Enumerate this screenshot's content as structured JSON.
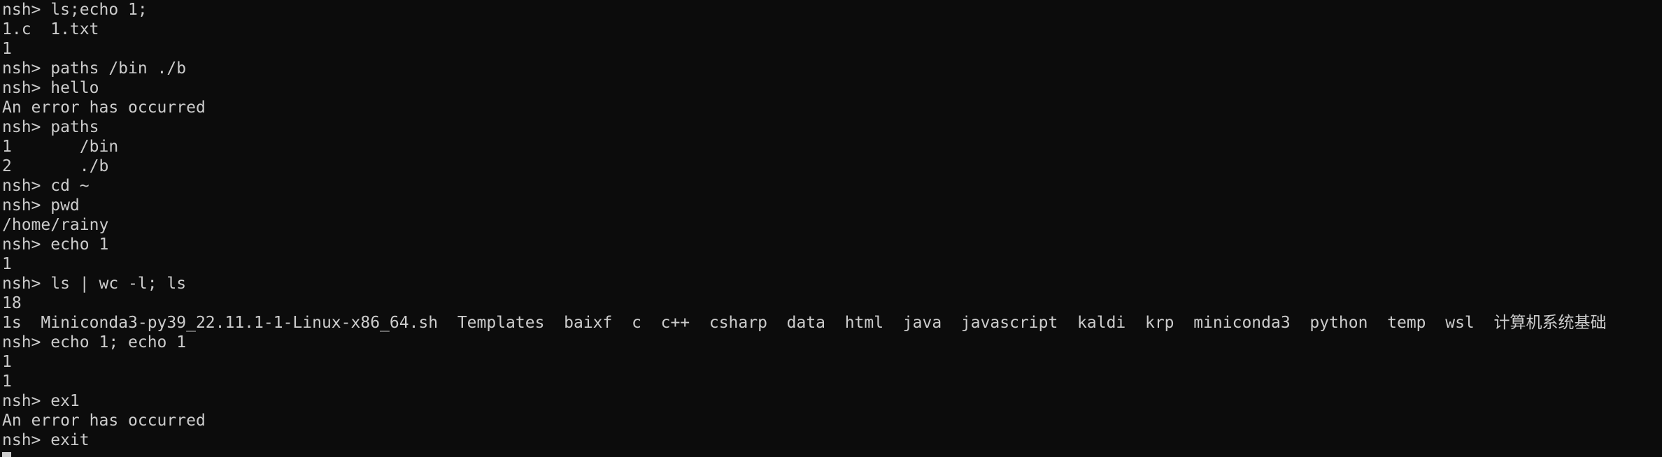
{
  "terminal": {
    "lines": [
      "nsh> ls;echo 1;",
      "1.c  1.txt",
      "1",
      "nsh> paths /bin ./b",
      "nsh> hello",
      "An error has occurred",
      "nsh> paths",
      "1       /bin",
      "2       ./b",
      "nsh> cd ~",
      "nsh> pwd",
      "/home/rainy",
      "nsh> echo 1",
      "1",
      "nsh> ls | wc -l; ls",
      "18",
      "1s  Miniconda3-py39_22.11.1-1-Linux-x86_64.sh  Templates  baixf  c  c++  csharp  data  html  java  javascript  kaldi  krp  miniconda3  python  temp  wsl  计算机系统基础",
      "nsh> echo 1; echo 1",
      "1",
      "1",
      "nsh> ex1",
      "An error has occurred",
      "nsh> exit"
    ]
  },
  "colors": {
    "background": "#0c0c0c",
    "foreground": "#cccccc"
  }
}
